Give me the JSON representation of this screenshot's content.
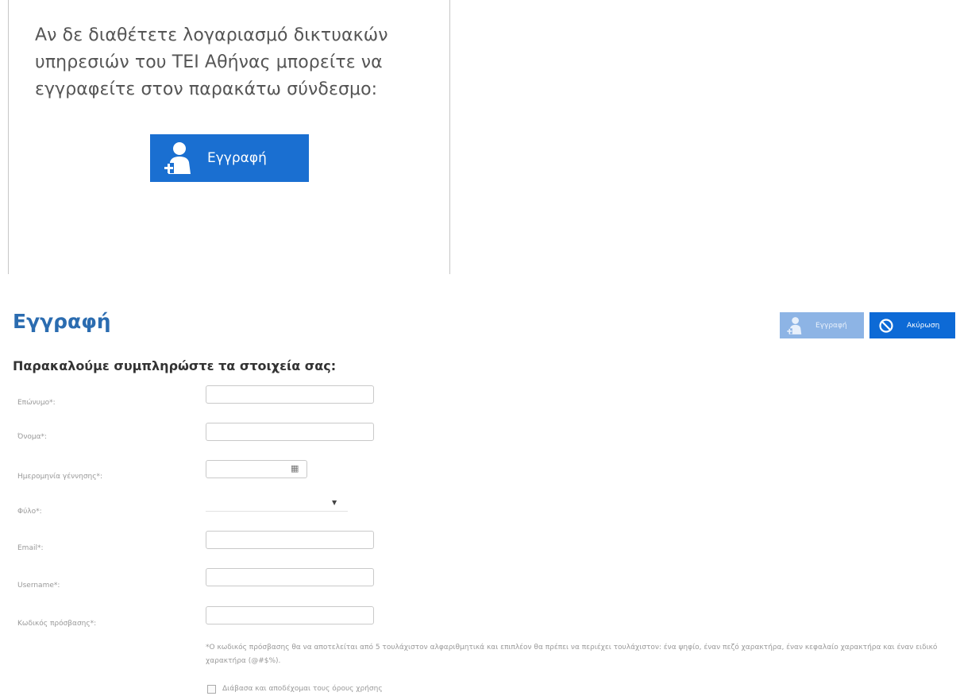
{
  "intro": {
    "text": "Αν δε διαθέτετε λογαριασμό δικτυακών υπηρεσιών του ΤΕΙ Αθήνας μπορείτε να εγγραφείτε στον παρακάτω σύνδεσμο:",
    "signup_button_label": "Εγγραφή"
  },
  "page": {
    "title": "Εγγραφή",
    "subtitle": "Παρακαλούμε συμπληρώστε τα στοιχεία σας:"
  },
  "toolbar": {
    "register_label": "Εγγραφή",
    "cancel_label": "Ακύρωση"
  },
  "form": {
    "surname_label": "Επώνυμο*:",
    "name_label": "Όνομα*:",
    "birthdate_label": "Ημερομηνία γέννησης*:",
    "gender_label": "Φύλο*:",
    "email_label": "Email*:",
    "username_label": "Username*:",
    "password_label": "Κωδικός πρόσβασης*:",
    "password_note": "*Ο κωδικός πρόσβασης θα να αποτελείται από 5 τουλάχιστον αλφαριθμητικά και επιπλέον θα πρέπει να περιέχει τουλάχιστον: ένα ψηφίο, έναν πεζό χαρακτήρα, έναν κεφαλαίο χαρακτήρα και έναν ειδικό χαρακτήρα (@#$%).",
    "terms_label": "Διάβασα και αποδέχομαι τους όρους χρήσης"
  },
  "icons": {
    "user_add": "user-add-icon",
    "cancel": "ban-icon",
    "calendar": "calendar-icon",
    "dropdown": "chevron-down-icon"
  },
  "colors": {
    "primary": "#1a6fd1",
    "title": "#2b6cb0",
    "disabled": "#8db4e5"
  }
}
